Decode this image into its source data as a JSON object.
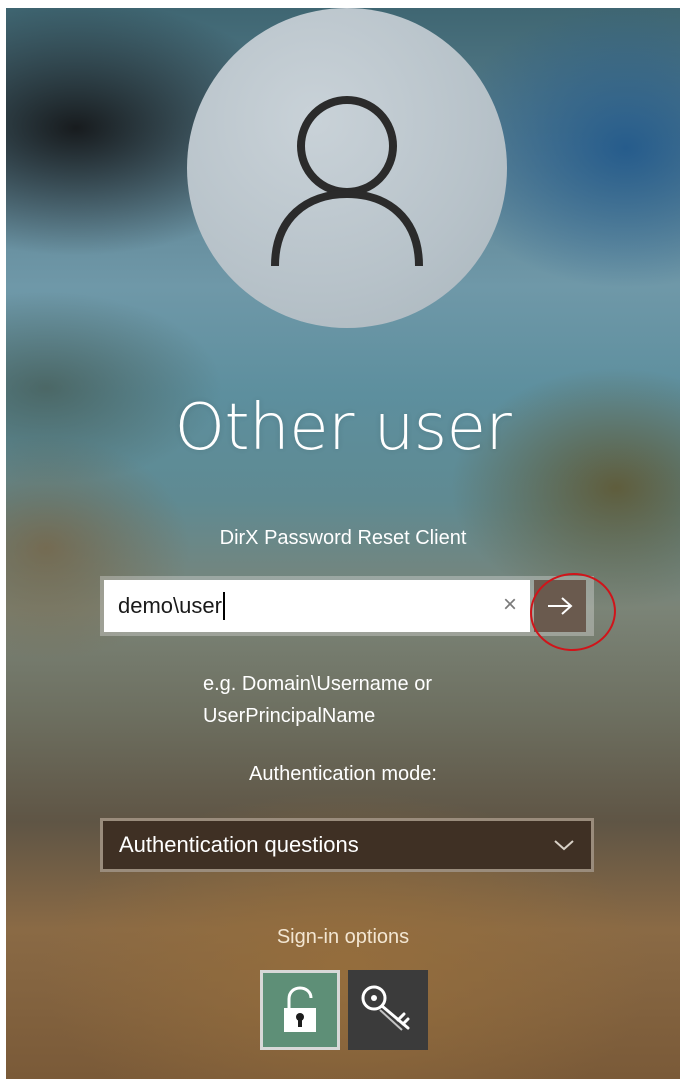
{
  "login": {
    "user_name": "Other user",
    "provider": "DirX Password Reset Client",
    "username_value": "demo\\user",
    "clear_glyph": "×",
    "hint_line1": "e.g. Domain\\Username or",
    "hint_line2": "UserPrincipalName",
    "auth_mode_label": "Authentication mode:",
    "auth_mode_selected": "Authentication questions",
    "signin_options_label": "Sign-in options"
  },
  "icons": {
    "avatar": "user-silhouette-icon",
    "submit": "arrow-right-icon",
    "clear": "close-icon",
    "dropdown": "chevron-down-icon",
    "option1": "unlock-icon",
    "option2": "keys-icon"
  },
  "colors": {
    "submit_button": "#6a5a4e",
    "selected_option": "#5e8f77",
    "annotation": "#d0141a",
    "dropdown_bg": "#3f3024"
  }
}
